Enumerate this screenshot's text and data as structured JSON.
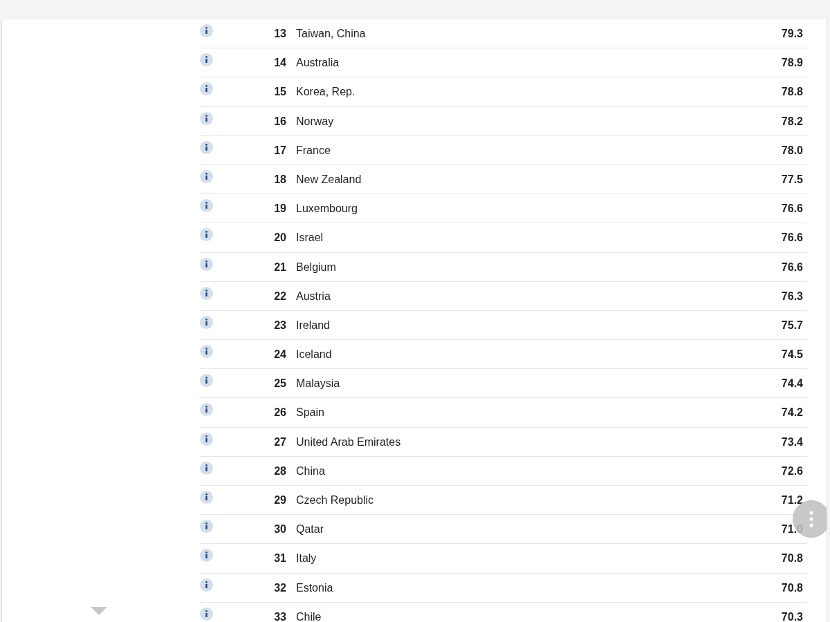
{
  "rows": [
    {
      "rank": "13",
      "country": "Taiwan, China",
      "value": "79.3"
    },
    {
      "rank": "14",
      "country": "Australia",
      "value": "78.9"
    },
    {
      "rank": "15",
      "country": "Korea, Rep.",
      "value": "78.8"
    },
    {
      "rank": "16",
      "country": "Norway",
      "value": "78.2"
    },
    {
      "rank": "17",
      "country": "France",
      "value": "78.0"
    },
    {
      "rank": "18",
      "country": "New Zealand",
      "value": "77.5"
    },
    {
      "rank": "19",
      "country": "Luxembourg",
      "value": "76.6"
    },
    {
      "rank": "20",
      "country": "Israel",
      "value": "76.6"
    },
    {
      "rank": "21",
      "country": "Belgium",
      "value": "76.6"
    },
    {
      "rank": "22",
      "country": "Austria",
      "value": "76.3"
    },
    {
      "rank": "23",
      "country": "Ireland",
      "value": "75.7"
    },
    {
      "rank": "24",
      "country": "Iceland",
      "value": "74.5"
    },
    {
      "rank": "25",
      "country": "Malaysia",
      "value": "74.4"
    },
    {
      "rank": "26",
      "country": "Spain",
      "value": "74.2"
    },
    {
      "rank": "27",
      "country": "United Arab Emirates",
      "value": "73.4"
    },
    {
      "rank": "28",
      "country": "China",
      "value": "72.6"
    },
    {
      "rank": "29",
      "country": "Czech Republic",
      "value": "71.2"
    },
    {
      "rank": "30",
      "country": "Qatar",
      "value": "71.0"
    },
    {
      "rank": "31",
      "country": "Italy",
      "value": "70.8"
    },
    {
      "rank": "32",
      "country": "Estonia",
      "value": "70.8"
    },
    {
      "rank": "33",
      "country": "Chile",
      "value": "70.3"
    }
  ]
}
